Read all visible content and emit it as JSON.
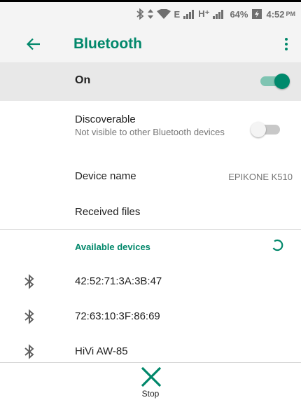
{
  "status_bar": {
    "network_e": "E",
    "network_h": "H⁺",
    "battery": "64%",
    "time": "4:52",
    "ampm": "PM"
  },
  "app_bar": {
    "title": "Bluetooth",
    "back_icon": "arrow-left",
    "menu_icon": "more-vert"
  },
  "master_switch": {
    "label": "On",
    "state": true
  },
  "settings": {
    "discoverable": {
      "title": "Discoverable",
      "subtitle": "Not visible to other Bluetooth devices",
      "state": false
    },
    "device_name": {
      "title": "Device name",
      "value": "EPIKONE K510"
    },
    "received_files": {
      "title": "Received files"
    }
  },
  "available_devices": {
    "header": "Available devices",
    "devices": [
      {
        "name": "42:52:71:3A:3B:47"
      },
      {
        "name": "72:63:10:3F:86:69"
      },
      {
        "name": "HiVi AW-85"
      }
    ]
  },
  "bottom_action": {
    "label": "Stop"
  },
  "colors": {
    "accent": "#00876a",
    "toggle_on_thumb": "#00896c",
    "toggle_on_track": "#7fc4b2",
    "header_bg": "#f4f4f4",
    "highlight_row_bg": "#e8e8e8"
  }
}
